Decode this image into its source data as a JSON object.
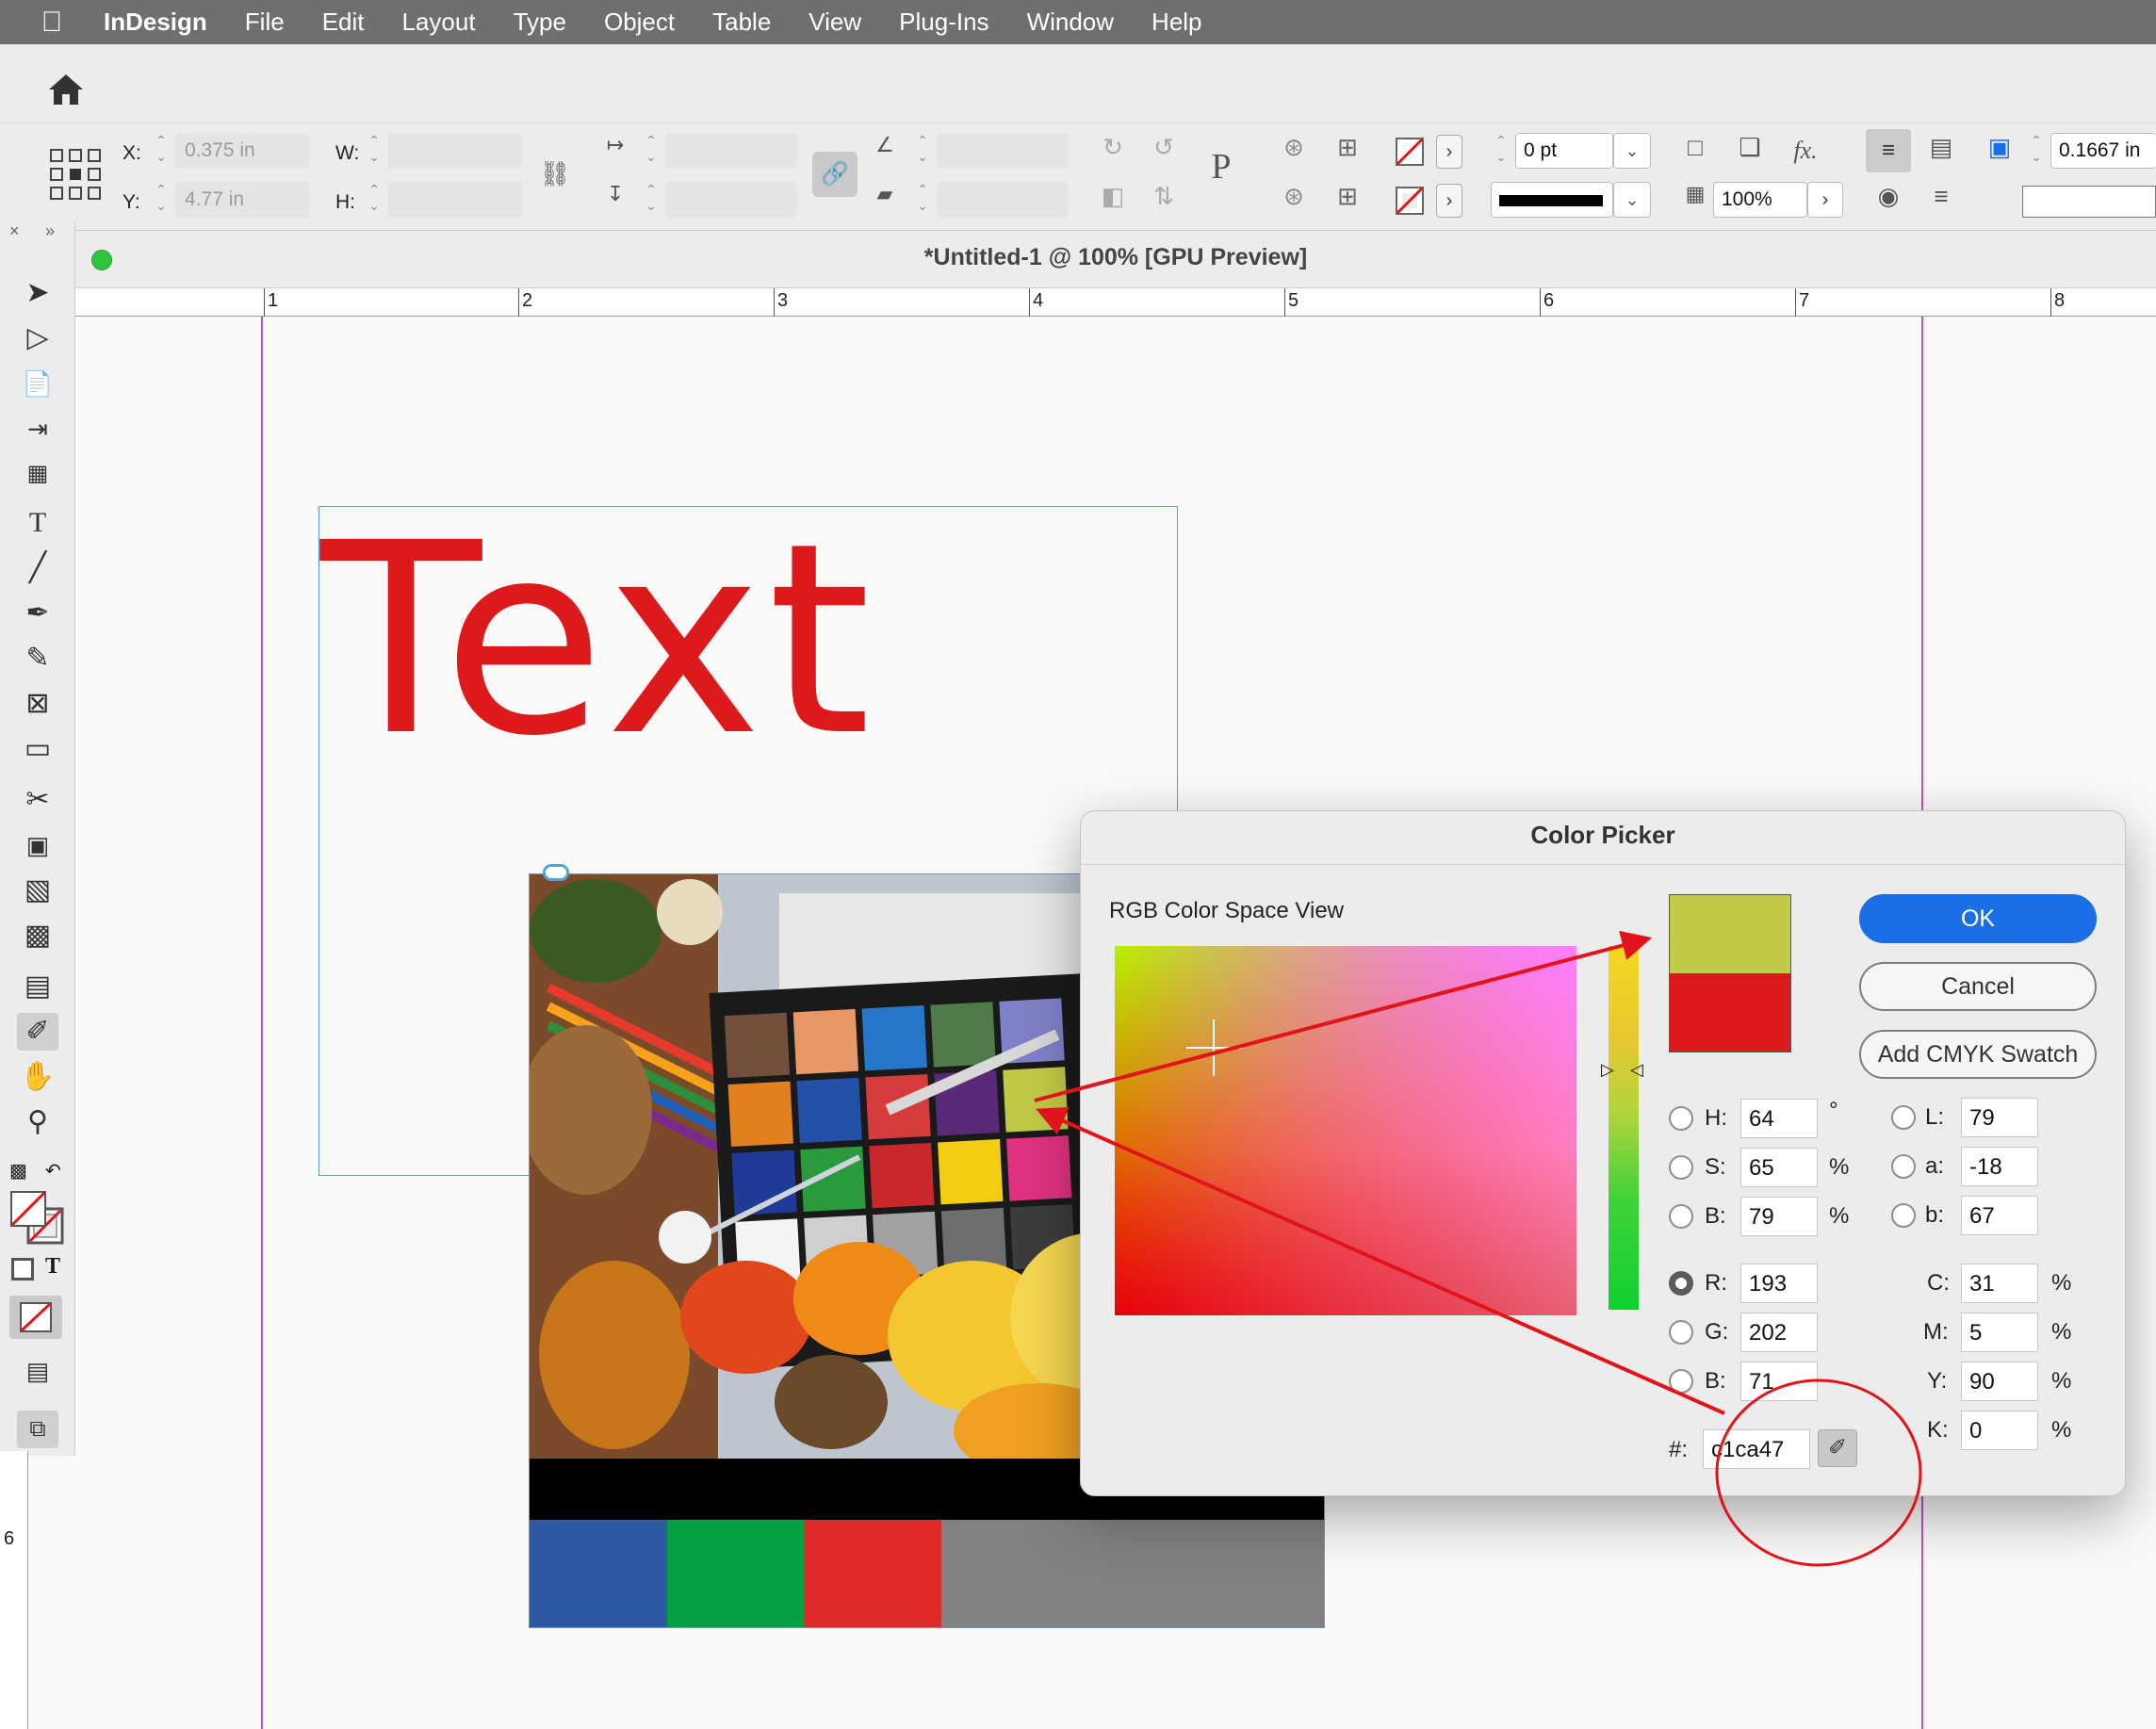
{
  "menubar": {
    "apple": "",
    "app": "InDesign",
    "items": [
      "File",
      "Edit",
      "Layout",
      "Type",
      "Object",
      "Table",
      "View",
      "Plug-Ins",
      "Window",
      "Help"
    ]
  },
  "control": {
    "x_label": "X:",
    "x_value": "0.375 in",
    "y_label": "Y:",
    "y_value": "4.77 in",
    "w_label": "W:",
    "h_label": "H:",
    "stroke_weight": "0 pt",
    "opacity": "100%",
    "offset_value": "0.1667 in",
    "fx_label": "fx."
  },
  "document": {
    "title": "*Untitled-1 @ 100% [GPU Preview]"
  },
  "ruler": {
    "marks": [
      "1",
      "2",
      "3",
      "4",
      "5",
      "6",
      "7",
      "8"
    ],
    "vertical_mark": "6"
  },
  "canvas": {
    "text": "Text",
    "text_color": "#dc1a1c"
  },
  "dialog": {
    "title": "Color Picker",
    "space_view_label": "RGB Color Space View",
    "ok_label": "OK",
    "cancel_label": "Cancel",
    "add_swatch_label": "Add CMYK Swatch",
    "new_color": "#c1ca47",
    "old_color": "#dc1a1c",
    "hsb": [
      {
        "label": "H:",
        "value": "64",
        "unit": "°"
      },
      {
        "label": "S:",
        "value": "65",
        "unit": "%"
      },
      {
        "label": "B:",
        "value": "79",
        "unit": "%"
      }
    ],
    "rgb": [
      {
        "label": "R:",
        "value": "193"
      },
      {
        "label": "G:",
        "value": "202"
      },
      {
        "label": "B:",
        "value": "71"
      }
    ],
    "lab": [
      {
        "label": "L:",
        "value": "79"
      },
      {
        "label": "a:",
        "value": "-18"
      },
      {
        "label": "b:",
        "value": "67"
      }
    ],
    "cmyk": [
      {
        "label": "C:",
        "value": "31",
        "unit": "%"
      },
      {
        "label": "M:",
        "value": "5",
        "unit": "%"
      },
      {
        "label": "Y:",
        "value": "90",
        "unit": "%"
      },
      {
        "label": "K:",
        "value": "0",
        "unit": "%"
      }
    ],
    "hex_label": "#:",
    "hex_value": "c1ca47"
  },
  "annotation_color": "#e0141a"
}
